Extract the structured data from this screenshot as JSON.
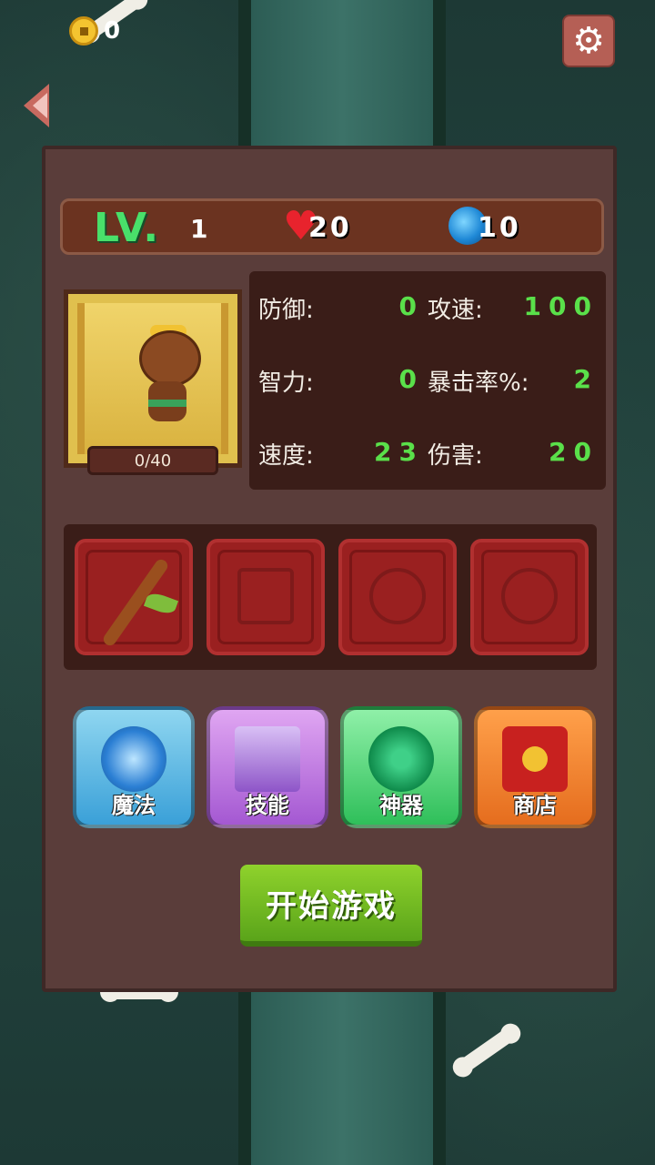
{
  "hud": {
    "coins": "0"
  },
  "player": {
    "level_label": "LV.",
    "level": "1",
    "hp": "20",
    "mana": "10",
    "xp": "0/40"
  },
  "stats": {
    "defense_label": "防御:",
    "defense": "0",
    "attack_speed_label": "攻速:",
    "attack_speed": "100",
    "intelligence_label": "智力:",
    "intelligence": "0",
    "crit_label": "暴击率%:",
    "crit": "2",
    "speed_label": "速度:",
    "speed": "23",
    "damage_label": "伤害:",
    "damage": "20"
  },
  "equipment": [
    {
      "icon": "branch-weapon-icon"
    },
    {
      "icon": "armor-empty-icon"
    },
    {
      "icon": "accessory-empty-icon"
    },
    {
      "icon": "accessory-empty-icon"
    }
  ],
  "menu": {
    "magic": "魔法",
    "skill": "技能",
    "artifact": "神器",
    "shop": "商店"
  },
  "start_label": "开始游戏"
}
